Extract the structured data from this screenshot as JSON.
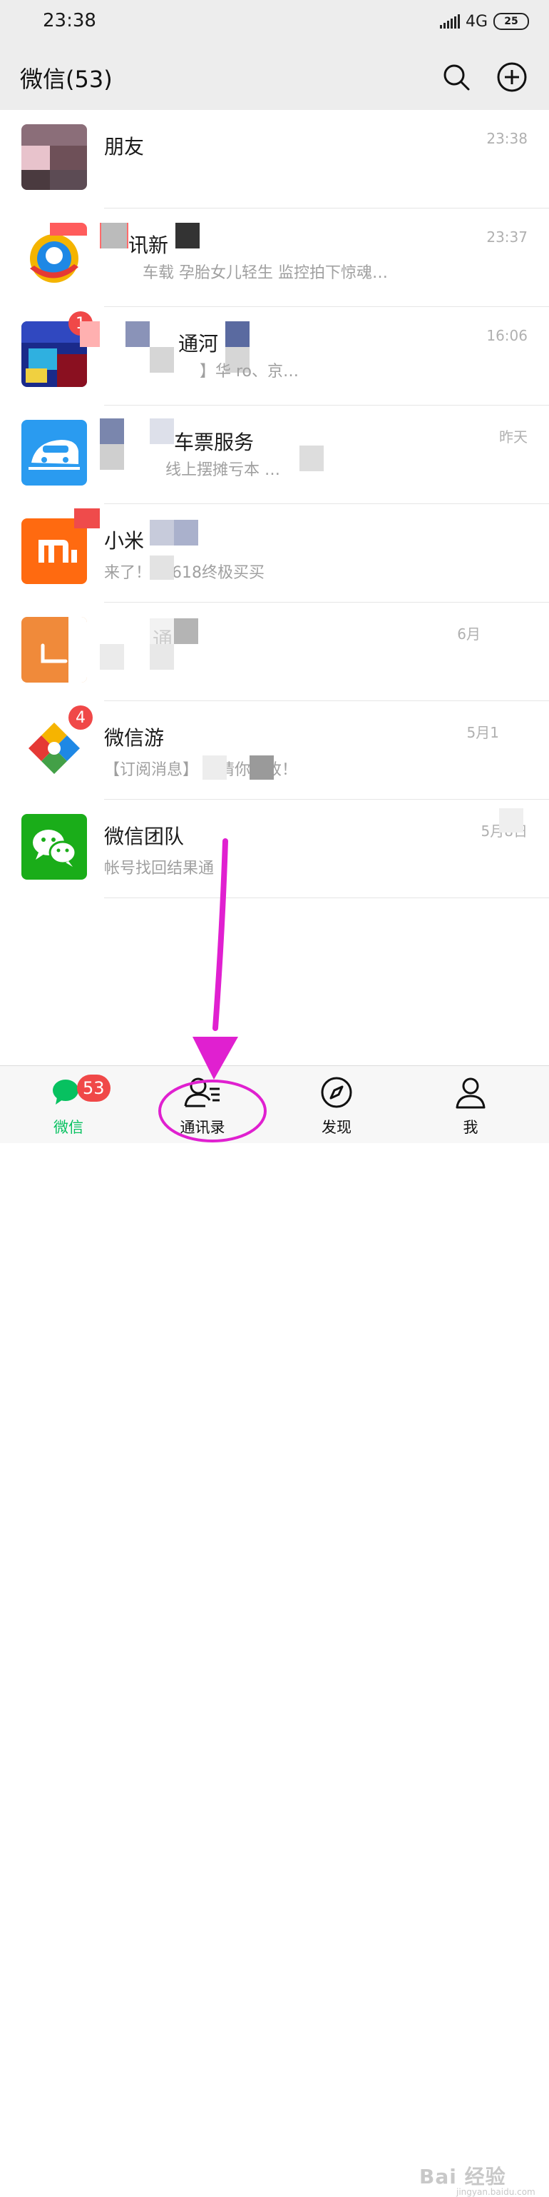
{
  "status_bar": {
    "time": "23:38",
    "network": "4G",
    "battery": "25"
  },
  "header": {
    "title": "微信(53)",
    "search_icon": "search-icon",
    "add_icon": "plus-circle-icon"
  },
  "chats": [
    {
      "name": "朋友",
      "preview": "",
      "time": "23:38"
    },
    {
      "name": "讯新",
      "preview": "车载      孕胎女儿轻生 监控拍下惊魂…",
      "time": "23:37"
    },
    {
      "name": "通河",
      "preview": "】华          ro、京…",
      "time": "16:06",
      "badge": "1"
    },
    {
      "name": "车票服务",
      "preview": "线上摆摊亏本          …",
      "time": "昨天"
    },
    {
      "name": "小米",
      "preview": "来了！       米618终极买买",
      "time": ""
    },
    {
      "name": "通",
      "preview": "",
      "time": "6月"
    },
    {
      "name": "微信游",
      "preview": "【订阅消息】          ，请你查收！",
      "time": "5月1",
      "badge": "4"
    },
    {
      "name": "微信团队",
      "preview": "帐号找回结果通",
      "time": "5月8日"
    }
  ],
  "tabbar": {
    "tabs": [
      {
        "label": "微信",
        "icon": "chat-bubbles-icon",
        "badge": "53",
        "active": true
      },
      {
        "label": "通讯录",
        "icon": "contacts-icon"
      },
      {
        "label": "发现",
        "icon": "compass-icon"
      },
      {
        "label": "我",
        "icon": "person-icon"
      }
    ]
  },
  "watermark": {
    "text": "Bai 经验",
    "sub": "jingyan.baidu.com"
  },
  "colors": {
    "accent_green": "#07c160",
    "badge_red": "#f04848",
    "annotation_magenta": "#e020d0",
    "header_bg": "#ededed"
  }
}
